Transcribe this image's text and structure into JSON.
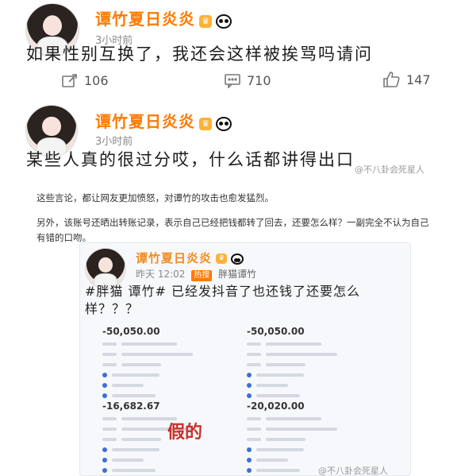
{
  "post1": {
    "username": "谭竹夏日炎炎",
    "time": "3小时前",
    "text": "如果性别互换了，我还会这样被挨骂吗请问",
    "stats": {
      "repost": "106",
      "comment": "710",
      "like": "147"
    }
  },
  "post2": {
    "username": "谭竹夏日炎炎",
    "time": "3小时前",
    "text": "某些人真的很过分哎，什么话都讲得出口",
    "watermark": "@不八卦会死星人"
  },
  "article": {
    "para1": "这些言论，都让网友更加愤怒，对谭竹的攻击也愈发猛烈。",
    "para2": "另外，该账号还晒出转账记录，表示自己已经把钱都转了回去，还要怎么样？一副完全不认为自己有错的口吻。"
  },
  "embed": {
    "username": "谭竹夏日炎炎",
    "time": "昨天 12:02",
    "hot": "热搜",
    "hot_topic": "胖猫谭竹",
    "text": "#胖猫 谭竹# 已经发抖音了也还钱了还要怎么样？？？",
    "records": [
      {
        "amount": "-50,050.00"
      },
      {
        "amount": "-50,050.00"
      },
      {
        "amount": "-16,682.67"
      },
      {
        "amount": "-20,020.00"
      }
    ],
    "fake_label": "假的",
    "watermark": "@不八卦会死星人"
  },
  "colors": {
    "username": "#ff7a00",
    "topic": "#3b6fd8",
    "fake": "#c8302a"
  }
}
